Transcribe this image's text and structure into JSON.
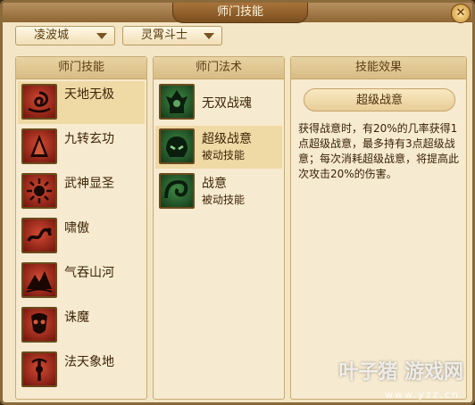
{
  "window": {
    "title": "师门技能",
    "close": "✕"
  },
  "dropdowns": {
    "sect": "凌波城",
    "role": "灵霄斗士"
  },
  "panels": {
    "sect_skills": {
      "header": "师门技能",
      "items": [
        {
          "name": "天地无极",
          "icon": "swirl-icon",
          "selected": true
        },
        {
          "name": "九转玄功",
          "icon": "pagoda-icon"
        },
        {
          "name": "武神显圣",
          "icon": "sun-burst-icon"
        },
        {
          "name": "啸傲",
          "icon": "dragon-icon"
        },
        {
          "name": "气吞山河",
          "icon": "mountain-icon"
        },
        {
          "name": "诛魔",
          "icon": "demon-mask-icon"
        },
        {
          "name": "法天象地",
          "icon": "staff-icon"
        }
      ]
    },
    "sect_spells": {
      "header": "师门法术",
      "items": [
        {
          "name": "无双战魂",
          "sub": "",
          "icon": "warrior-spirit-icon"
        },
        {
          "name": "超级战意",
          "sub": "被动技能",
          "icon": "helmet-icon",
          "selected": true
        },
        {
          "name": "战意",
          "sub": "被动技能",
          "icon": "wave-icon"
        }
      ]
    },
    "effect": {
      "header": "技能效果",
      "skill_name": "超级战意",
      "description": "获得战意时，有20%的几率获得1点超级战意，最多持有3点超级战意；每次消耗超级战意，将提高此次攻击20%的伤害。"
    }
  },
  "watermark": {
    "main": "叶子猪 游戏网",
    "sub": "www.yzz.cn"
  }
}
